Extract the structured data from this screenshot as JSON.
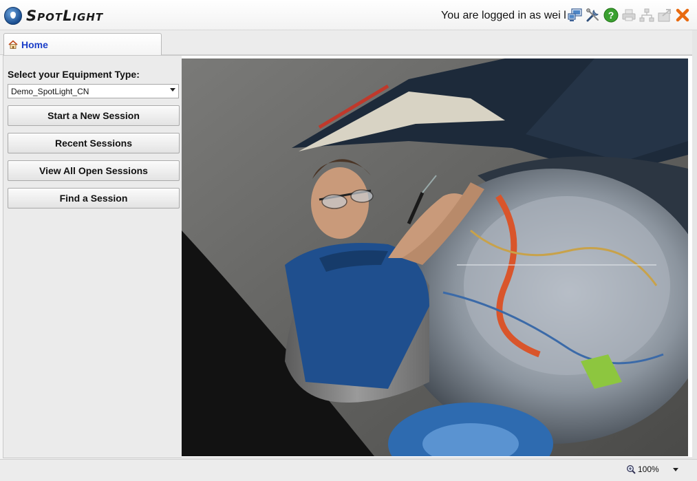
{
  "app": {
    "name": "SpotLight",
    "login_text": "You are logged in as wei li"
  },
  "toolbar": {
    "icons": [
      "computer-network-icon",
      "tools-icon",
      "help-icon",
      "print-icon",
      "hierarchy-icon",
      "export-icon",
      "close-icon"
    ]
  },
  "tabs": [
    {
      "label": "Home",
      "icon": "home-icon"
    }
  ],
  "sidebar": {
    "equipment_label": "Select your Equipment Type:",
    "equipment_value": "Demo_SpotLight_CN",
    "buttons": {
      "start": "Start a New Session",
      "recent": "Recent Sessions",
      "view_all": "View All Open Sessions",
      "find": "Find a Session"
    }
  },
  "status": {
    "zoom": "100%"
  },
  "colors": {
    "tab_text": "#1a3ec8",
    "help_green": "#3aa030",
    "close_orange": "#e86a10",
    "logo_blue": "#1a4d8f"
  }
}
